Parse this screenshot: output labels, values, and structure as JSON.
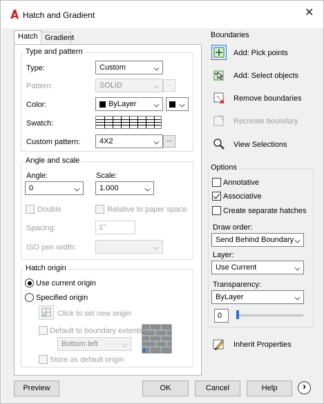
{
  "window": {
    "title": "Hatch and Gradient",
    "close_glyph": "✕"
  },
  "tabs": [
    {
      "label": "Hatch",
      "active": true
    },
    {
      "label": "Gradient",
      "active": false
    }
  ],
  "type_pattern": {
    "group_title": "Type and pattern",
    "type_label": "Type:",
    "type_value": "Custom",
    "pattern_label": "Pattern:",
    "pattern_value": "SOLID",
    "color_label": "Color:",
    "color_value": "ByLayer",
    "swatch_label": "Swatch:",
    "custom_pattern_label": "Custom pattern:",
    "custom_pattern_value": "4X2",
    "ellipsis": "..."
  },
  "angle_scale": {
    "group_title": "Angle and scale",
    "angle_label": "Angle:",
    "angle_value": "0",
    "scale_label": "Scale:",
    "scale_value": "1.000",
    "double_label": "Double",
    "relative_label": "Relative to paper space",
    "spacing_label": "Spacing:",
    "spacing_value": "1\"",
    "iso_label": "ISO pen width:"
  },
  "hatch_origin": {
    "group_title": "Hatch origin",
    "use_current_label": "Use current origin",
    "specified_label": "Specified origin",
    "click_set_label": "Click to set new origin",
    "default_boundary_label": "Default to boundary extents",
    "boundary_select_value": "Bottom left",
    "store_default_label": "Store as default origin"
  },
  "boundaries": {
    "group_title": "Boundaries",
    "items": [
      {
        "label": "Add: Pick points",
        "enabled": true,
        "icon": "pick-points-icon"
      },
      {
        "label": "Add: Select objects",
        "enabled": true,
        "icon": "select-objects-icon"
      },
      {
        "label": "Remove boundaries",
        "enabled": true,
        "icon": "remove-boundaries-icon"
      },
      {
        "label": "Recreate boundary",
        "enabled": false,
        "icon": "recreate-boundary-icon"
      },
      {
        "label": "View Selections",
        "enabled": true,
        "icon": "magnifier-icon"
      }
    ]
  },
  "options": {
    "group_title": "Options",
    "annotative_label": "Annotative",
    "annotative_checked": false,
    "associative_label": "Associative",
    "associative_checked": true,
    "separate_label": "Create separate hatches",
    "separate_checked": false,
    "draw_order_label": "Draw order:",
    "draw_order_value": "Send Behind Boundary",
    "layer_label": "Layer:",
    "layer_value": "Use Current",
    "transparency_label": "Transparency:",
    "transparency_value": "ByLayer",
    "transparency_number": "0"
  },
  "inherit": {
    "label": "Inherit Properties"
  },
  "footer": {
    "preview": "Preview",
    "ok": "OK",
    "cancel": "Cancel",
    "help": "Help",
    "more_glyph": "›"
  },
  "colors": {
    "accent": "#2b6fd6",
    "autocad_red": "#c9272c",
    "disabled_text": "#a0a0a0"
  }
}
